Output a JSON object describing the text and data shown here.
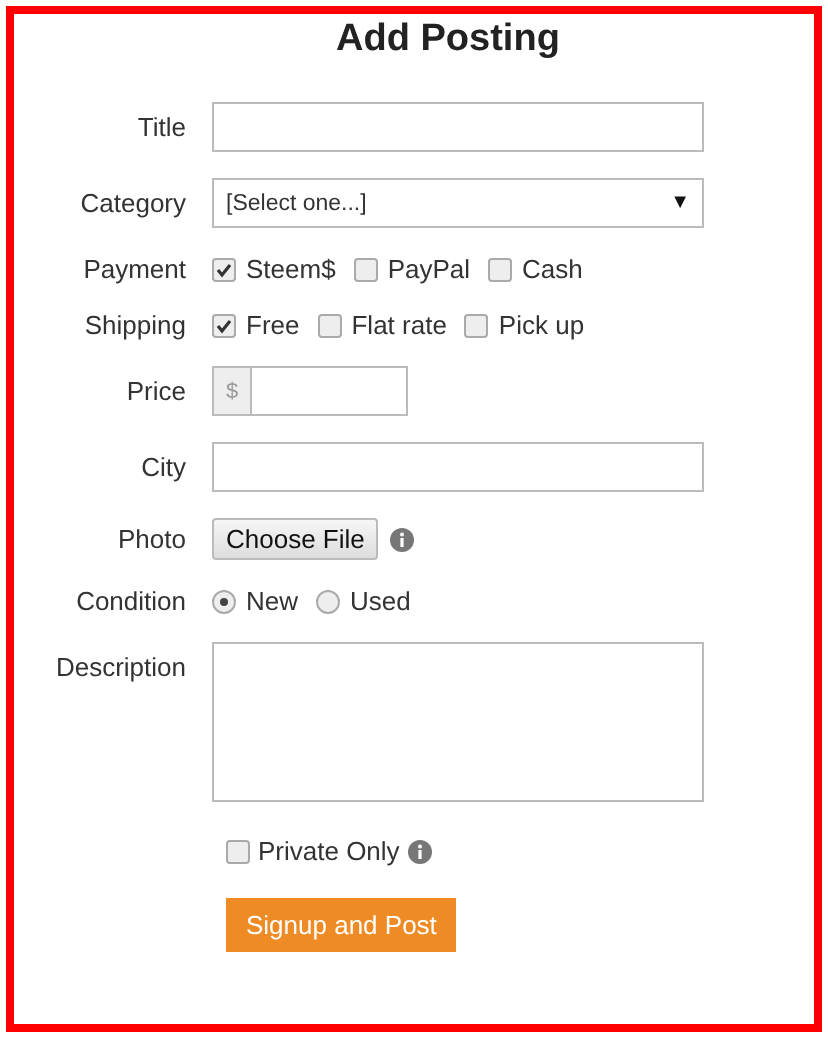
{
  "title": "Add Posting",
  "fields": [
    {
      "label": "Title",
      "kind": "text"
    },
    {
      "label": "Category",
      "kind": "select",
      "value": "[Select one...]",
      "arrow": "▼"
    },
    {
      "label": "Payment",
      "kind": "checkboxes",
      "options": [
        {
          "label": "Steem$",
          "checked": true
        },
        {
          "label": "PayPal",
          "checked": false
        },
        {
          "label": "Cash",
          "checked": false
        }
      ]
    },
    {
      "label": "Shipping",
      "kind": "checkboxes",
      "options": [
        {
          "label": "Free",
          "checked": true
        },
        {
          "label": "Flat rate",
          "checked": false
        },
        {
          "label": "Pick up",
          "checked": false
        }
      ]
    },
    {
      "label": "Price",
      "kind": "price",
      "prefix": "$"
    },
    {
      "label": "City",
      "kind": "text"
    },
    {
      "label": "Photo",
      "kind": "file",
      "button": "Choose File"
    },
    {
      "label": "Condition",
      "kind": "radios",
      "options": [
        {
          "label": "New",
          "selected": true
        },
        {
          "label": "Used",
          "selected": false
        }
      ]
    },
    {
      "label": "Description",
      "kind": "textarea"
    }
  ],
  "private": {
    "label": "Private Only",
    "checked": false
  },
  "submit": "Signup and Post"
}
